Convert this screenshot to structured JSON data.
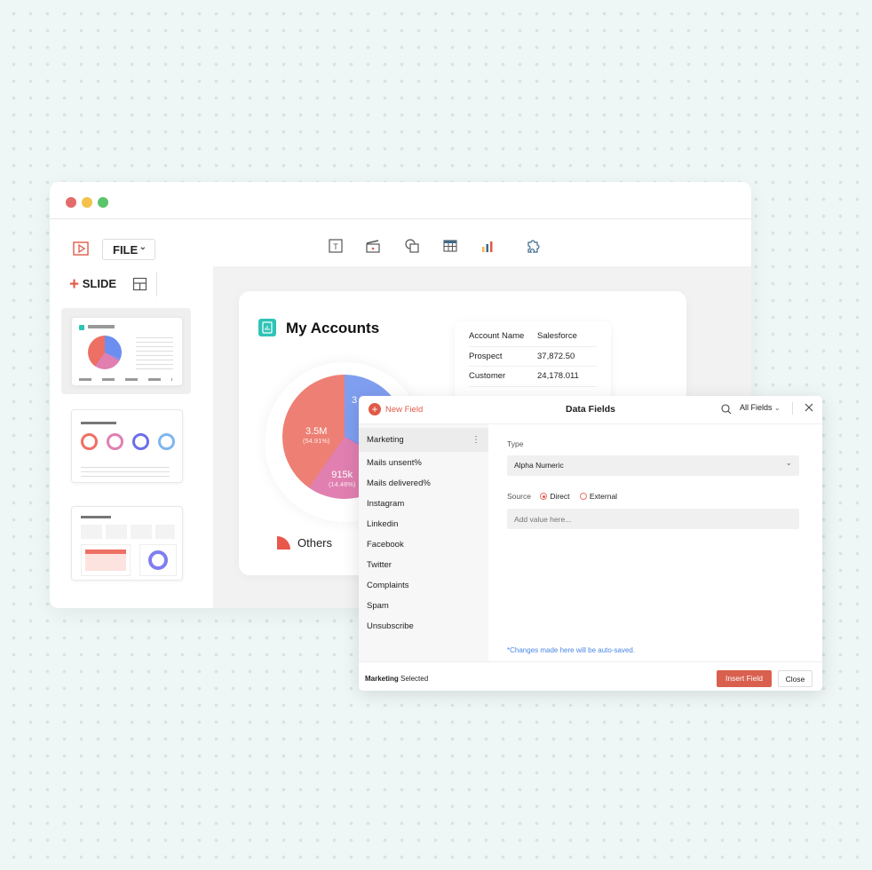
{
  "colors": {
    "accent": "#e05a48",
    "background": "#eef6f6",
    "teal": "#2ec4b6",
    "link": "#4a86e8"
  },
  "window": {
    "controls": [
      {
        "name": "close",
        "color": "#e36c6a"
      },
      {
        "name": "minimize",
        "color": "#f4c14b"
      },
      {
        "name": "maximize",
        "color": "#5cc46b"
      }
    ]
  },
  "toolbar": {
    "file_label": "FILE",
    "tools": [
      "text-box-icon",
      "media-clapper-icon",
      "shape-icon",
      "table-icon",
      "chart-icon",
      "extension-puzzle-icon"
    ]
  },
  "sidebar": {
    "add_slide_label": "SLIDE"
  },
  "card": {
    "title": "My Accounts",
    "table": [
      [
        "Account Name",
        "Salesforce"
      ],
      [
        "Prospect",
        "37,872.50"
      ],
      [
        "Customer",
        "24,178.011"
      ]
    ],
    "pie": {
      "slices": [
        {
          "label": "3.5M",
          "pct": "(54.91%)",
          "color": "#ee7f74"
        },
        {
          "label": "915k",
          "pct": "(14.46%)",
          "color": "#e07fb0"
        },
        {
          "label": "3",
          "color": "#7f9ef0"
        }
      ]
    },
    "legend": [
      {
        "label": "Others",
        "color": "#e8574a"
      }
    ]
  },
  "dialog": {
    "new_field_label": "New Field",
    "title": "Data Fields",
    "filter_label": "All Fields",
    "list": [
      "Marketing",
      "Mails unsent%",
      "Mails delivered%",
      "Instagram",
      "Linkedin",
      "Facebook",
      "Twitter",
      "Complaints",
      "Spam",
      "Unsubscribe"
    ],
    "type_label": "Type",
    "type_value": "Alpha Numeric",
    "source_label": "Source",
    "source_options": [
      "Direct",
      "External"
    ],
    "source_selected": "Direct",
    "value_placeholder": "Add value here...",
    "note": "*Changes made here will be auto-saved.",
    "footer_selected_name": "Marketing",
    "footer_selected_suffix": "Selected",
    "insert_label": "Insert Field",
    "close_label": "Close"
  }
}
